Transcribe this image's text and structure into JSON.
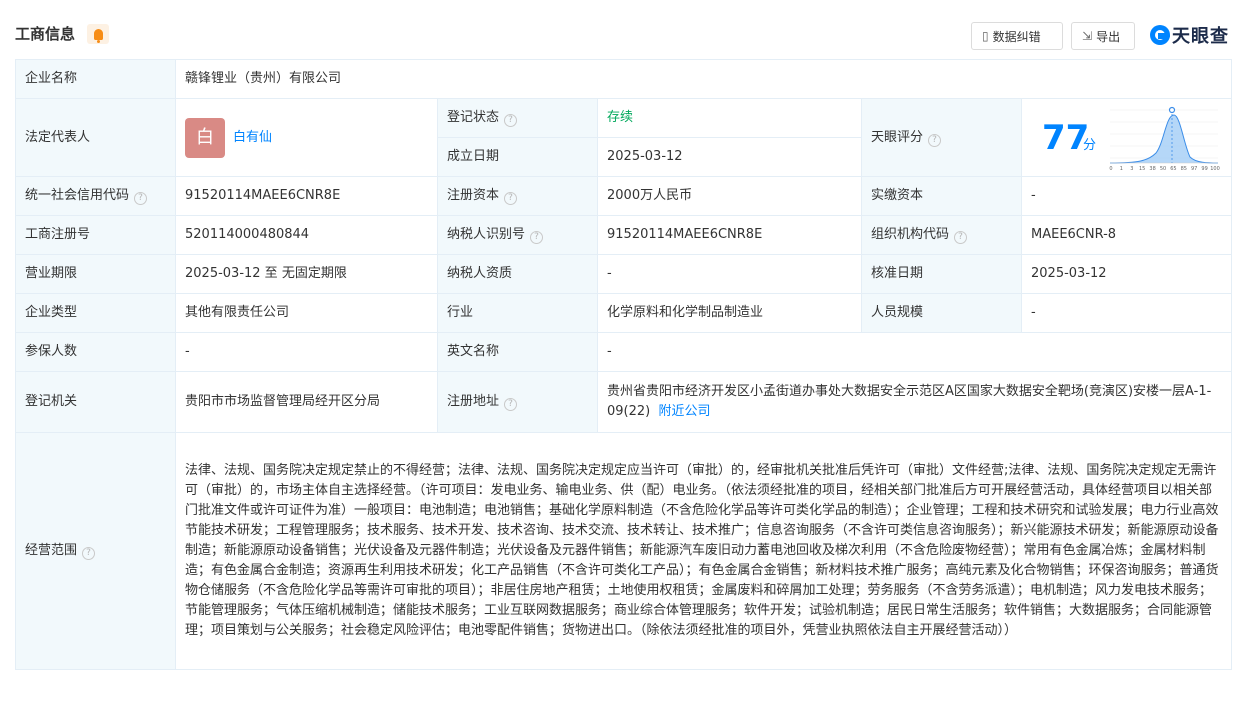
{
  "header": {
    "title": "工商信息",
    "correct_label": "数据纠错",
    "export_label": "导出",
    "brand": "天眼查"
  },
  "company": {
    "name_label": "企业名称",
    "name": "赣锋锂业（贵州）有限公司",
    "legal_rep_label": "法定代表人",
    "legal_rep_avatar": "白",
    "legal_rep": "白有仙",
    "reg_status_label": "登记状态",
    "reg_status": "存续",
    "est_date_label": "成立日期",
    "est_date": "2025-03-12",
    "score_label": "天眼评分",
    "score": "77",
    "score_unit": "分",
    "score_ticks": [
      "0",
      "1",
      "3",
      "15",
      "38",
      "50",
      "65",
      "85",
      "97",
      "99",
      "100"
    ],
    "credit_code_label": "统一社会信用代码",
    "credit_code": "91520114MAEE6CNR8E",
    "reg_capital_label": "注册资本",
    "reg_capital": "2000万人民币",
    "paid_capital_label": "实缴资本",
    "paid_capital": "-",
    "reg_no_label": "工商注册号",
    "reg_no": "520114000480844",
    "tax_id_label": "纳税人识别号",
    "tax_id": "91520114MAEE6CNR8E",
    "org_code_label": "组织机构代码",
    "org_code": "MAEE6CNR-8",
    "term_label": "营业期限",
    "term": "2025-03-12 至 无固定期限",
    "taxpayer_qual_label": "纳税人资质",
    "taxpayer_qual": "-",
    "approve_date_label": "核准日期",
    "approve_date": "2025-03-12",
    "type_label": "企业类型",
    "type": "其他有限责任公司",
    "industry_label": "行业",
    "industry": "化学原料和化学制品制造业",
    "staff_size_label": "人员规模",
    "staff_size": "-",
    "insured_label": "参保人数",
    "insured": "-",
    "english_name_label": "英文名称",
    "english_name": "-",
    "authority_label": "登记机关",
    "authority": "贵阳市市场监督管理局经开区分局",
    "address_label": "注册地址",
    "address": "贵州省贵阳市经济开发区小孟街道办事处大数据安全示范区A区国家大数据安全靶场(竞演区)安楼一层A-1-09(22)",
    "nearby_link": "附近公司",
    "scope_label": "经营范围",
    "scope": "法律、法规、国务院决定规定禁止的不得经营；法律、法规、国务院决定规定应当许可（审批）的，经审批机关批准后凭许可（审批）文件经营;法律、法规、国务院决定规定无需许可（审批）的，市场主体自主选择经营。（许可项目：发电业务、输电业务、供（配）电业务。（依法须经批准的项目，经相关部门批准后方可开展经营活动，具体经营项目以相关部门批准文件或许可证件为准）一般项目：电池制造；电池销售；基础化学原料制造（不含危险化学品等许可类化学品的制造）；企业管理；工程和技术研究和试验发展；电力行业高效节能技术研发；工程管理服务；技术服务、技术开发、技术咨询、技术交流、技术转让、技术推广；信息咨询服务（不含许可类信息咨询服务）；新兴能源技术研发；新能源原动设备制造；新能源原动设备销售；光伏设备及元器件制造；光伏设备及元器件销售；新能源汽车废旧动力蓄电池回收及梯次利用（不含危险废物经营）；常用有色金属冶炼；金属材料制造；有色金属合金制造；资源再生利用技术研发；化工产品销售（不含许可类化工产品）；有色金属合金销售；新材料技术推广服务；高纯元素及化合物销售；环保咨询服务；普通货物仓储服务（不含危险化学品等需许可审批的项目）；非居住房地产租赁；土地使用权租赁；金属废料和碎屑加工处理；劳务服务（不含劳务派遣）；电机制造；风力发电技术服务；节能管理服务；气体压缩机械制造；储能技术服务；工业互联网数据服务；商业综合体管理服务；软件开发；试验机制造；居民日常生活服务；软件销售；大数据服务；合同能源管理；项目策划与公关服务；社会稳定风险评估；电池零配件销售；货物进出口。（除依法须经批准的项目外，凭营业执照依法自主开展经营活动））"
  },
  "colors": {
    "label_bg": "#f2f9fc",
    "border": "#e4eef6",
    "accent": "#0084ff",
    "status_green": "#00a85b",
    "avatar_bg": "#d98a85"
  },
  "icons": {
    "bell": "bell-icon",
    "correct": "edit-doc-icon",
    "export": "export-icon",
    "help": "question-circle-icon"
  }
}
